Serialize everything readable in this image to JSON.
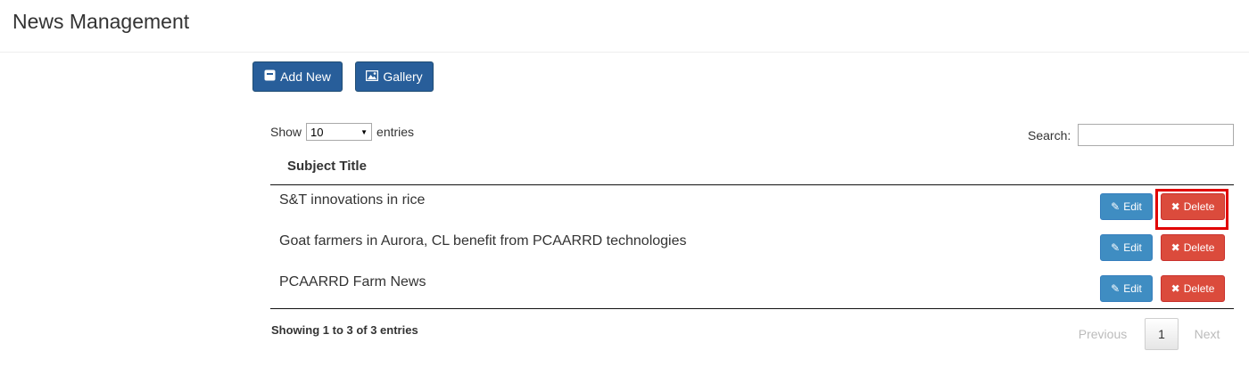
{
  "header": {
    "title": "News Management"
  },
  "toolbar": {
    "add_new_label": "Add New",
    "add_new_icon": "archive-icon",
    "gallery_label": "Gallery",
    "gallery_icon": "picture-icon"
  },
  "table_controls": {
    "show_label": "Show",
    "entries_label": "entries",
    "page_length_value": "10",
    "search_label": "Search:",
    "search_value": ""
  },
  "table": {
    "columns": [
      "Subject Title"
    ],
    "rows": [
      {
        "title": "S&T innovations in rice",
        "edit_label": "Edit",
        "delete_label": "Delete"
      },
      {
        "title": "Goat farmers in Aurora, CL benefit from PCAARRD technologies",
        "edit_label": "Edit",
        "delete_label": "Delete"
      },
      {
        "title": "PCAARRD Farm News",
        "edit_label": "Edit",
        "delete_label": "Delete"
      }
    ]
  },
  "footer": {
    "info": "Showing 1 to 3 of 3 entries",
    "previous_label": "Previous",
    "current_page": "1",
    "next_label": "Next"
  },
  "colors": {
    "primary": "#285e9a",
    "edit": "#3f8dc2",
    "delete": "#db4b3c",
    "highlight": "#e10000"
  }
}
